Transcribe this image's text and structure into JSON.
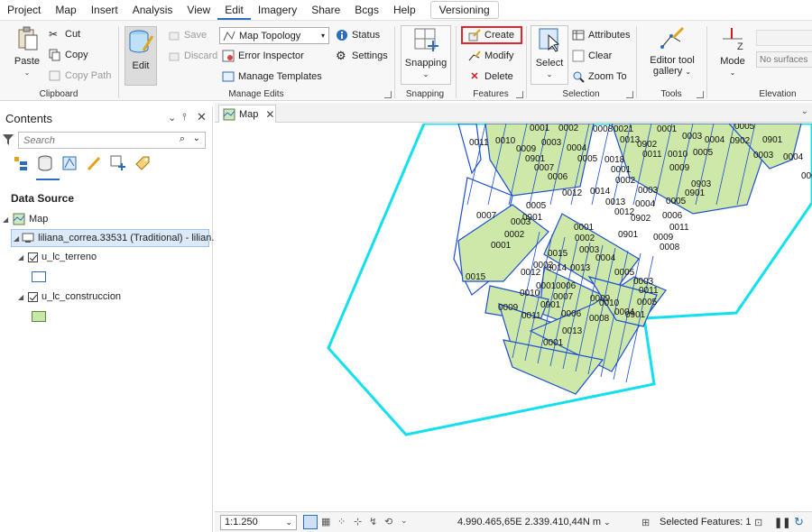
{
  "menu": {
    "items": [
      "Project",
      "Map",
      "Insert",
      "Analysis",
      "View",
      "Edit",
      "Imagery",
      "Share",
      "Bcgs",
      "Help"
    ],
    "active": "Edit",
    "versioning_tab": "Versioning"
  },
  "ribbon": {
    "clipboard": {
      "paste": "Paste",
      "cut": "Cut",
      "copy": "Copy",
      "copy_path": "Copy Path",
      "label": "Clipboard"
    },
    "manage_edits": {
      "edit": "Edit",
      "save": "Save",
      "discard": "Discard",
      "topology_select": "Map Topology",
      "error_inspector": "Error Inspector",
      "manage_templates": "Manage Templates",
      "status": "Status",
      "settings": "Settings",
      "label": "Manage Edits"
    },
    "snapping": {
      "button": "Snapping",
      "label": "Snapping"
    },
    "features": {
      "create": "Create",
      "modify": "Modify",
      "delete": "Delete",
      "label": "Features"
    },
    "selection": {
      "select": "Select",
      "attributes": "Attributes",
      "clear": "Clear",
      "zoom_to": "Zoom To",
      "label": "Selection"
    },
    "tools": {
      "gallery_line1": "Editor tool",
      "gallery_line2": "gallery",
      "label": "Tools"
    },
    "elevation": {
      "mode": "Mode",
      "surface_placeholder": "No surfaces",
      "label": "Elevation"
    }
  },
  "contents": {
    "title": "Contents",
    "search_placeholder": "Search",
    "section": "Data Source",
    "map_node": "Map",
    "connection_node": "liliana_correa.33531 (Traditional) - lilian...",
    "layers": [
      {
        "name": "u_lc_terreno",
        "visible": true,
        "swatch_fill": "#ffffff",
        "swatch_stroke": "#2a6ebb"
      },
      {
        "name": "u_lc_construccion",
        "visible": true,
        "swatch_fill": "#c8e6a8",
        "swatch_stroke": "#5a8a3a"
      }
    ]
  },
  "map_tab": {
    "label": "Map"
  },
  "map": {
    "labels": [
      "0011",
      "0010",
      "0001",
      "0002",
      "0003",
      "0004",
      "0009",
      "0005",
      "0901",
      "0007",
      "0006",
      "0012",
      "0008",
      "0021",
      "0013",
      "0001",
      "0902",
      "0003",
      "0004",
      "0011",
      "0010",
      "0005",
      "0018",
      "0009",
      "0001",
      "0002",
      "0903",
      "0901",
      "0014",
      "0003",
      "0005",
      "0013",
      "0004",
      "0012",
      "0006",
      "0011",
      "0902",
      "0901",
      "0009",
      "0008",
      "0005",
      "0902",
      "0901",
      "0003",
      "0004",
      "0001",
      "0007",
      "0005",
      "0003",
      "0901",
      "0002",
      "0001",
      "0001",
      "0002",
      "0003",
      "0004",
      "0015",
      "0014",
      "0013",
      "0005",
      "0015",
      "0001",
      "0002",
      "0012",
      "0006",
      "0011",
      "0007",
      "0010",
      "0009",
      "0010",
      "0003",
      "0004",
      "0005",
      "0009",
      "0901",
      "0006",
      "0008",
      "0901",
      "0011",
      "0013",
      "0001"
    ],
    "colors": {
      "boundary": "#12e0ee",
      "parcel": "#1d4fd1",
      "construction": "#cde8a9"
    }
  },
  "status": {
    "scale": "1:1.250",
    "coordinates": "4.990.465,65E 2.339.410,44N m",
    "selected": "Selected Features: 1"
  }
}
